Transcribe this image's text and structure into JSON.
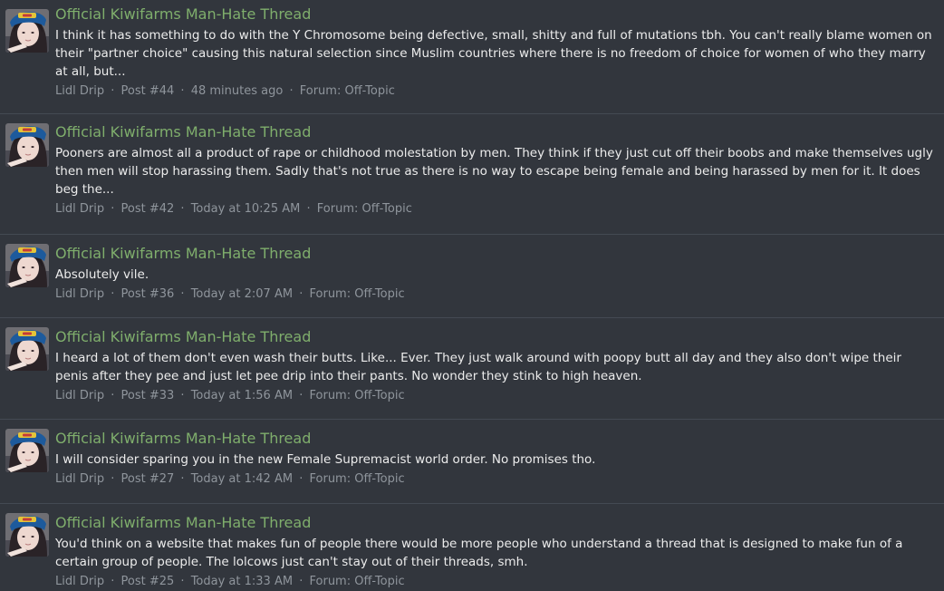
{
  "results": [
    {
      "title": "Official Kiwifarms Man-Hate Thread",
      "snippet": "I think it has something to do with the Y Chromosome being defective, small, shitty and full of mutations tbh. You can't really blame women on their \"partner choice\" causing this natural selection since Muslim countries where there is no freedom of choice for women of who they marry at all, but...",
      "author": "Lidl Drip",
      "post": "Post #44",
      "time": "48 minutes ago",
      "forum": "Forum: Off-Topic"
    },
    {
      "title": "Official Kiwifarms Man-Hate Thread",
      "snippet": "Pooners are almost all a product of rape or childhood molestation by men. They think if they just cut off their boobs and make themselves ugly then men will stop harassing them. Sadly that's not true as there is no way to escape being female and being harassed by men for it. It does beg the...",
      "author": "Lidl Drip",
      "post": "Post #42",
      "time": "Today at 10:25 AM",
      "forum": "Forum: Off-Topic"
    },
    {
      "title": "Official Kiwifarms Man-Hate Thread",
      "snippet": "Absolutely vile.",
      "author": "Lidl Drip",
      "post": "Post #36",
      "time": "Today at 2:07 AM",
      "forum": "Forum: Off-Topic"
    },
    {
      "title": "Official Kiwifarms Man-Hate Thread",
      "snippet": "I heard a lot of them don't even wash their butts. Like... Ever. They just walk around with poopy butt all day and they also don't wipe their penis after they pee and just let pee drip into their pants. No wonder they stink to high heaven.",
      "author": "Lidl Drip",
      "post": "Post #33",
      "time": "Today at 1:56 AM",
      "forum": "Forum: Off-Topic"
    },
    {
      "title": "Official Kiwifarms Man-Hate Thread",
      "snippet": "I will consider sparing you in the new Female Supremacist world order. No promises tho.",
      "author": "Lidl Drip",
      "post": "Post #27",
      "time": "Today at 1:42 AM",
      "forum": "Forum: Off-Topic"
    },
    {
      "title": "Official Kiwifarms Man-Hate Thread",
      "snippet": "You'd think on a website that makes fun of people there would be more people who understand a thread that is designed to make fun of a certain group of people. The lolcows just can't stay out of their threads, smh.",
      "author": "Lidl Drip",
      "post": "Post #25",
      "time": "Today at 1:33 AM",
      "forum": "Forum: Off-Topic"
    }
  ],
  "meta_separator": "·",
  "colors": {
    "background": "#32363d",
    "title": "#7fae6c",
    "meta": "#8f959c",
    "divider": "#444a53"
  },
  "icons": {
    "avatar": "user-avatar"
  }
}
